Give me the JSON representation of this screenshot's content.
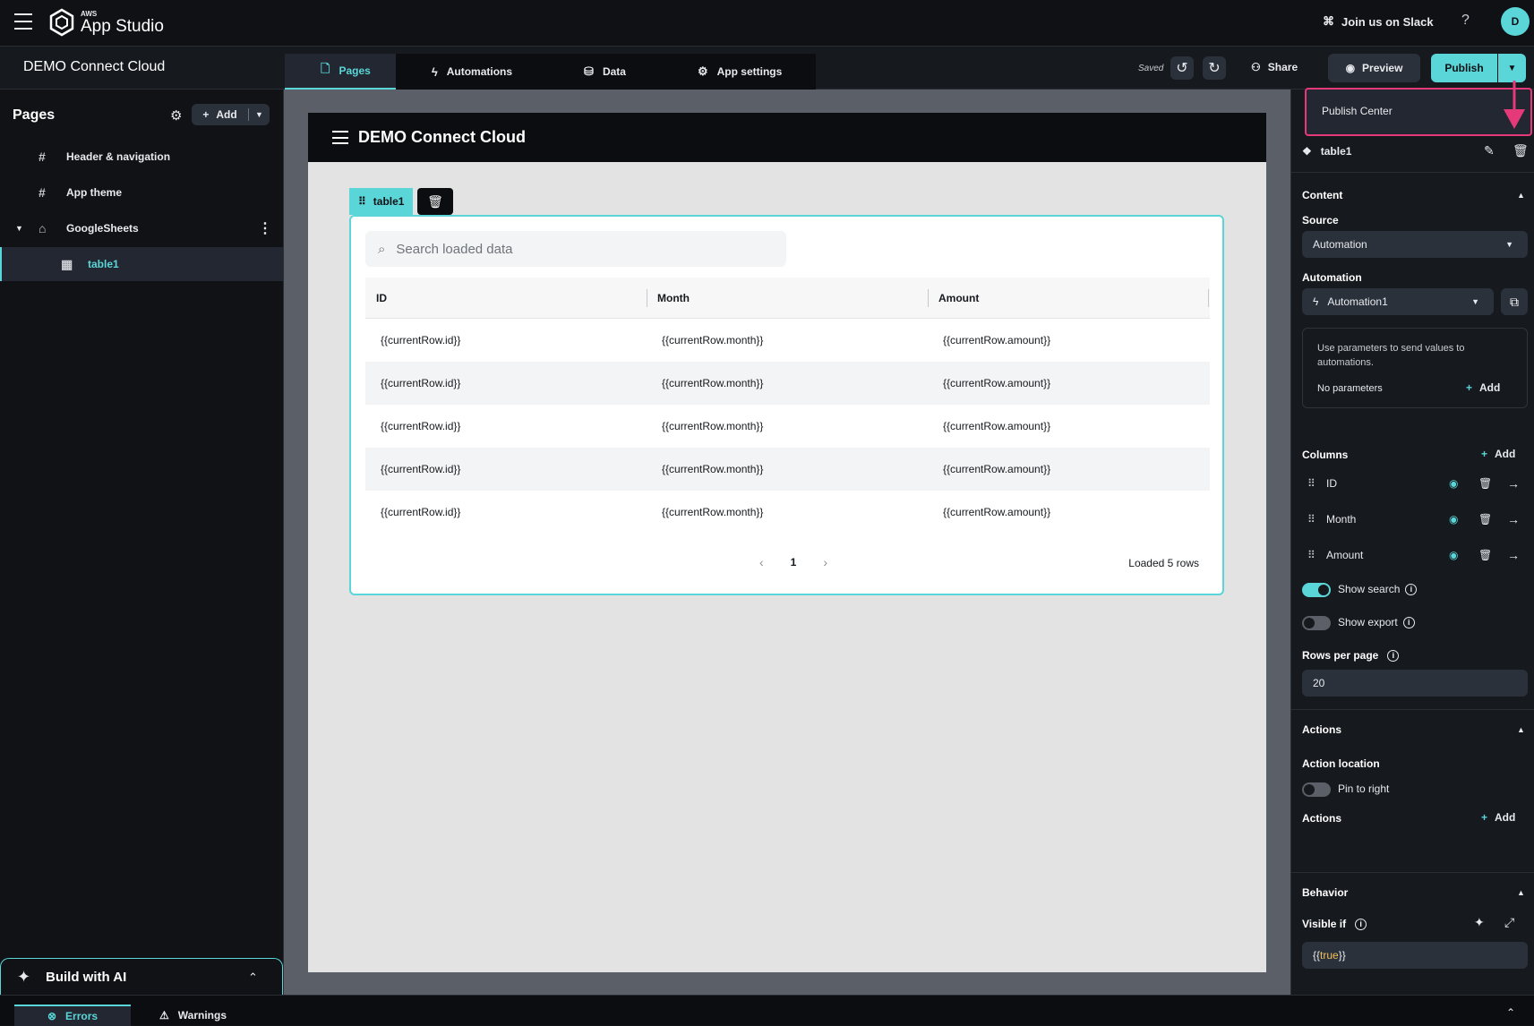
{
  "topbar": {
    "logo_small": "AWS",
    "logo_main": "App Studio",
    "slack_label": "Join us on Slack",
    "help_glyph": "?",
    "avatar_initial": "D"
  },
  "subbar": {
    "project_name": "DEMO Connect Cloud",
    "tabs": [
      {
        "label": "Pages",
        "icon": "page-icon"
      },
      {
        "label": "Automations",
        "icon": "lightning-icon"
      },
      {
        "label": "Data",
        "icon": "database-icon"
      },
      {
        "label": "App settings",
        "icon": "gear-icon"
      }
    ],
    "saved_label": "Saved",
    "share_label": "Share",
    "preview_label": "Preview",
    "publish_label": "Publish"
  },
  "publish_menu": {
    "item": "Publish Center",
    "highlight_color": "#e63979"
  },
  "sidebar": {
    "title": "Pages",
    "add_label": "Add",
    "items": [
      {
        "label": "Header & navigation",
        "icon": "hash-icon"
      },
      {
        "label": "App theme",
        "icon": "hash-icon"
      },
      {
        "label": "GoogleSheets",
        "icon": "home-icon"
      },
      {
        "label": "table1",
        "icon": "table-icon"
      }
    ],
    "build_ai_label": "Build with AI"
  },
  "footer": {
    "errors_label": "Errors",
    "warnings_label": "Warnings"
  },
  "canvas": {
    "app_title": "DEMO Connect Cloud",
    "component_tag": "table1",
    "search_placeholder": "Search loaded data",
    "columns": [
      "ID",
      "Month",
      "Amount"
    ],
    "rows": [
      [
        "{{currentRow.id}}",
        "{{currentRow.month}}",
        "{{currentRow.amount}}"
      ],
      [
        "{{currentRow.id}}",
        "{{currentRow.month}}",
        "{{currentRow.amount}}"
      ],
      [
        "{{currentRow.id}}",
        "{{currentRow.month}}",
        "{{currentRow.amount}}"
      ],
      [
        "{{currentRow.id}}",
        "{{currentRow.month}}",
        "{{currentRow.amount}}"
      ],
      [
        "{{currentRow.id}}",
        "{{currentRow.month}}",
        "{{currentRow.amount}}"
      ]
    ],
    "page_number": "1",
    "loaded_label": "Loaded 5 rows"
  },
  "properties": {
    "component_name": "table1",
    "content_title": "Content",
    "source_label": "Source",
    "source_value": "Automation",
    "automation_label": "Automation",
    "automation_value": "Automation1",
    "param_hint": "Use parameters to send values to automations.",
    "no_params": "No parameters",
    "add_label": "Add",
    "columns_label": "Columns",
    "columns": [
      "ID",
      "Month",
      "Amount"
    ],
    "show_search_label": "Show search",
    "show_search": true,
    "show_export_label": "Show export",
    "show_export": false,
    "rows_per_page_label": "Rows per page",
    "rows_per_page": "20",
    "actions_title": "Actions",
    "action_location_label": "Action location",
    "pin_to_right_label": "Pin to right",
    "pin_to_right": false,
    "actions_label": "Actions",
    "behavior_title": "Behavior",
    "visible_if_label": "Visible if",
    "visible_if_prefix": "{{",
    "visible_if_value": "true",
    "visible_if_suffix": "}}"
  },
  "colors": {
    "accent": "#5ad6d8",
    "background": "#101216",
    "panel": "#16191e"
  }
}
